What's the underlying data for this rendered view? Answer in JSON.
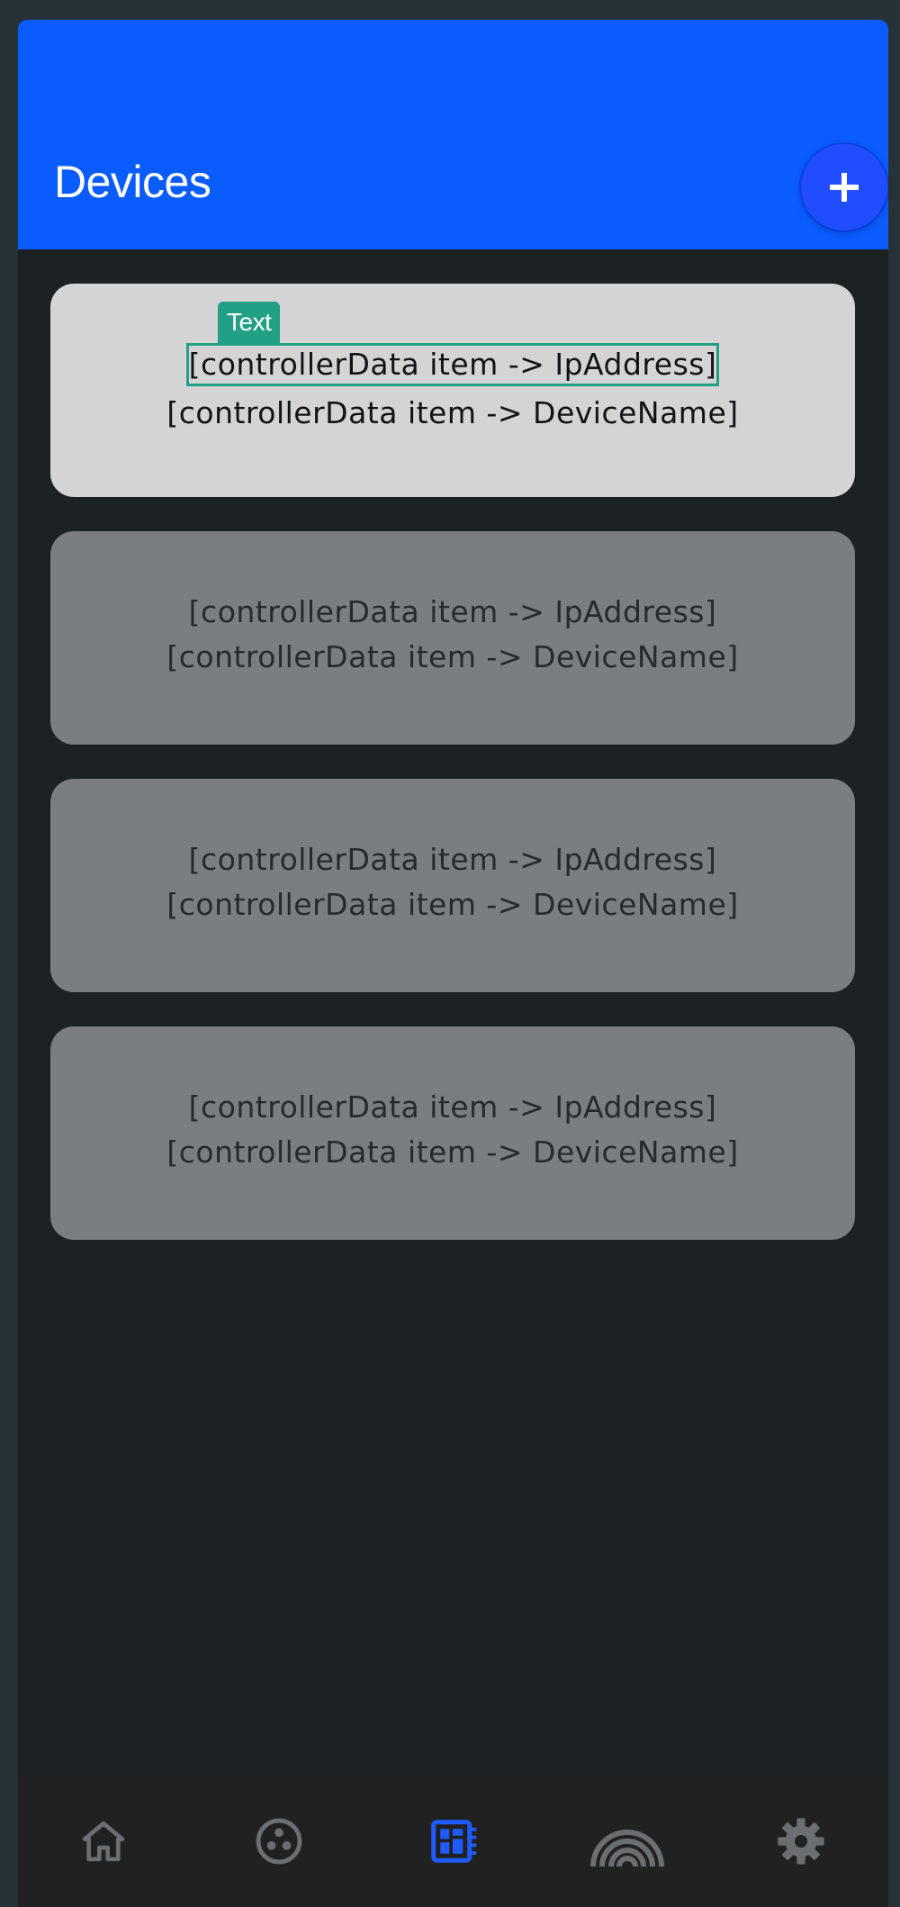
{
  "header": {
    "title": "Devices",
    "add_icon": "plus-icon",
    "color": "#0a5cff"
  },
  "selection_tag": "Text",
  "devices": [
    {
      "ip": "[controllerData item -> IpAddress]",
      "name": "[controllerData item -> DeviceName]",
      "selected": true
    },
    {
      "ip": "[controllerData item -> IpAddress]",
      "name": "[controllerData item -> DeviceName]",
      "selected": false
    },
    {
      "ip": "[controllerData item -> IpAddress]",
      "name": "[controllerData item -> DeviceName]",
      "selected": false
    },
    {
      "ip": "[controllerData item -> IpAddress]",
      "name": "[controllerData item -> DeviceName]",
      "selected": false
    }
  ],
  "bottom_nav": [
    {
      "icon": "home-icon",
      "active": false
    },
    {
      "icon": "dmx-connector-icon",
      "active": false
    },
    {
      "icon": "controller-board-icon",
      "active": true
    },
    {
      "icon": "rainbow-icon",
      "active": false
    },
    {
      "icon": "gear-icon",
      "active": false
    }
  ],
  "colors": {
    "accent": "#0a5cff",
    "selection_outline": "#22a085",
    "nav_inactive": "#6b6f71",
    "nav_active": "#1f5bff"
  }
}
